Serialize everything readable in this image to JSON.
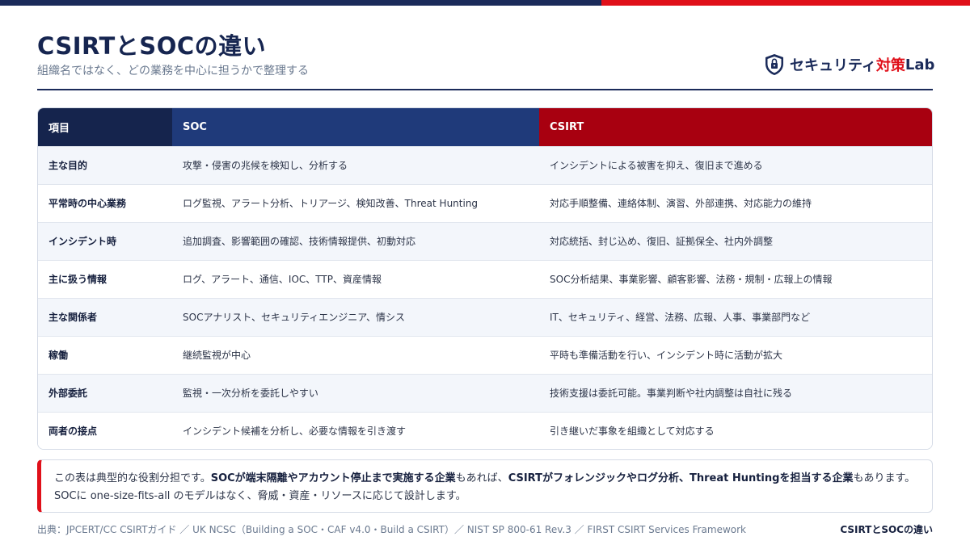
{
  "header": {
    "title": "CSIRTとSOCの違い",
    "subtitle": "組織名ではなく、どの業務を中心に担うかで整理する"
  },
  "logo": {
    "text_main": "セキュリティ",
    "text_accent": "対策",
    "text_end": "Lab",
    "icon": "shield-lock-icon"
  },
  "table": {
    "headers": [
      "項目",
      "SOC",
      "CSIRT"
    ],
    "rows": [
      [
        "主な目的",
        "攻撃・侵害の兆候を検知し、分析する",
        "インシデントによる被害を抑え、復旧まで進める"
      ],
      [
        "平常時の中心業務",
        "ログ監視、アラート分析、トリアージ、検知改善、Threat Hunting",
        "対応手順整備、連絡体制、演習、外部連携、対応能力の維持"
      ],
      [
        "インシデント時",
        "追加調査、影響範囲の確認、技術情報提供、初動対応",
        "対応統括、封じ込め、復旧、証拠保全、社内外調整"
      ],
      [
        "主に扱う情報",
        "ログ、アラート、通信、IOC、TTP、資産情報",
        "SOC分析結果、事業影響、顧客影響、法務・規制・広報上の情報"
      ],
      [
        "主な関係者",
        "SOCアナリスト、セキュリティエンジニア、情シス",
        "IT、セキュリティ、経営、法務、広報、人事、事業部門など"
      ],
      [
        "稼働",
        "継続監視が中心",
        "平時も準備活動を行い、インシデント時に活動が拡大"
      ],
      [
        "外部委託",
        "監視・一次分析を委託しやすい",
        "技術支援は委託可能。事業判断や社内調整は自社に残る"
      ],
      [
        "両者の接点",
        "インシデント候補を分析し、必要な情報を引き渡す",
        "引き継いだ事象を組織として対応する"
      ]
    ]
  },
  "note": {
    "p1": "この表は典型的な役割分担です。",
    "b1": "SOCが端末隔離やアカウント停止まで実施する企業",
    "p2": "もあれば、",
    "b2": "CSIRTがフォレンジックやログ分析、Threat Huntingを担当する企業",
    "p3": "もあります。SOCに one-size-fits-all のモデルはなく、脅威・資産・リソースに応じて設計します。"
  },
  "footer": {
    "source": "出典：JPCERT/CC CSIRTガイド ／ UK NCSC（Building a SOC・CAF v4.0・Build a CSIRT）／ NIST SP 800-61 Rev.3 ／ FIRST CSIRT Services Framework",
    "page_label": "CSIRTとSOCの違い"
  },
  "colors": {
    "navy": "#1b2b5a",
    "soc_header": "#1f3a7a",
    "csirt_header": "#a80010",
    "accent_red": "#e0101a"
  }
}
